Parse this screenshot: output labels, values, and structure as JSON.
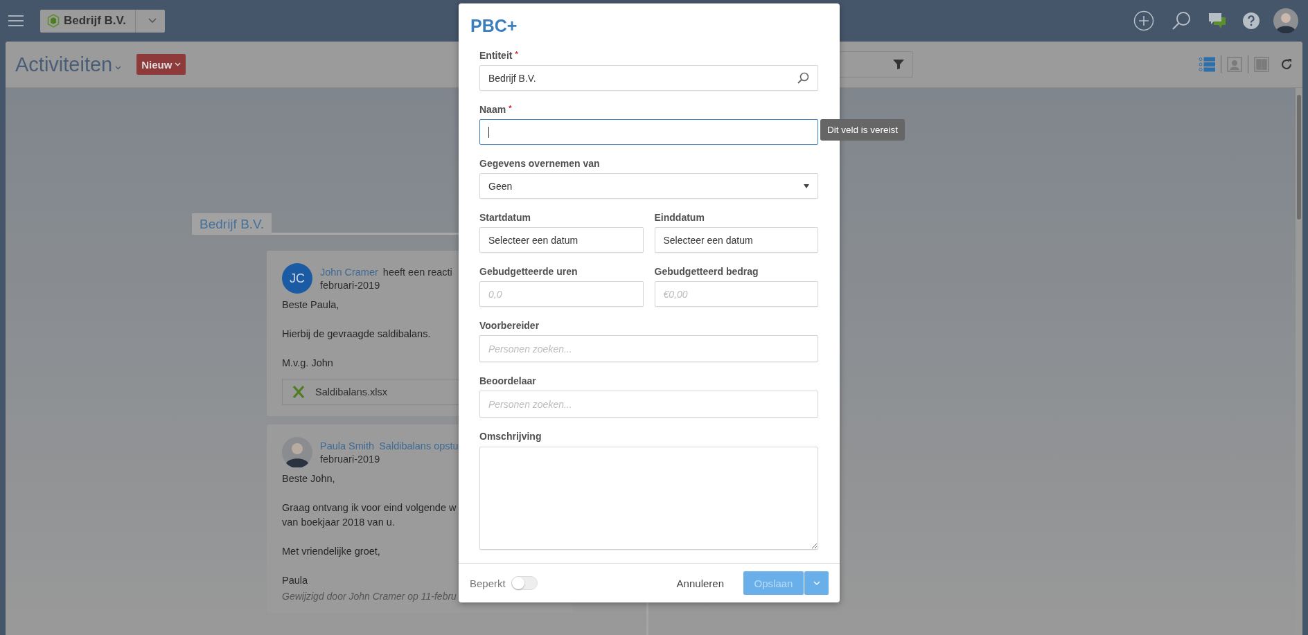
{
  "topbar": {
    "entity": "Bedrijf B.V."
  },
  "header": {
    "title": "Activiteiten",
    "new_button": "Nieuw"
  },
  "view_modes": [
    {
      "selected": true
    },
    {
      "selected": false
    },
    {
      "selected": false
    }
  ],
  "timeline": {
    "group": "Bedrijf B.V.",
    "posts": [
      {
        "kind": "initials",
        "initials": "JC",
        "author": "John Cramer",
        "action": "heeft een reacti",
        "action_is_link": false,
        "date": "februari-2019",
        "paragraphs": [
          "Beste Paula,",
          "Hierbij de gevraagde saldibalans.",
          "M.v.g. John"
        ],
        "attachment": "Saldibalans.xlsx"
      },
      {
        "kind": "photo",
        "author": "Paula Smith",
        "action": "Saldibalans opstu",
        "action_is_link": true,
        "date": "februari-2019",
        "paragraphs": [
          "Beste John,",
          "Graag ontvang ik voor eind volgende w\nvan boekjaar 2018 van u.",
          "Met vriendelijke groet,",
          "Paula"
        ],
        "edited_note": "Gewijzigd door John Cramer op 11-febru"
      }
    ]
  },
  "dialog": {
    "title": "PBC+",
    "required_mark": "*",
    "fields": [
      {
        "kind": "search",
        "label": "Entiteit",
        "required": true,
        "focused": false,
        "value": "Bedrijf B.V."
      },
      {
        "kind": "text",
        "label": "Naam",
        "required": true,
        "focused": true,
        "error": "Dit veld is vereist"
      },
      {
        "kind": "select",
        "label": "Gegevens overnemen van",
        "required": false,
        "focused": false,
        "value": "Geen"
      },
      {
        "kind": "pair",
        "items": [
          {
            "label": "Startdatum",
            "required": false,
            "focused": false,
            "value": "Selecteer een datum"
          },
          {
            "label": "Einddatum",
            "required": false,
            "focused": false,
            "value": "Selecteer een datum"
          }
        ]
      },
      {
        "kind": "pair",
        "items": [
          {
            "label": "Gebudgetteerde uren",
            "required": false,
            "focused": false,
            "placeholder": "0,0"
          },
          {
            "label": "Gebudgetteerd bedrag",
            "required": false,
            "focused": false,
            "placeholder": "€0,00"
          }
        ]
      },
      {
        "kind": "people",
        "label": "Voorbereider",
        "required": false,
        "focused": false,
        "placeholder": "Personen zoeken..."
      },
      {
        "kind": "people",
        "label": "Beoordelaar",
        "required": false,
        "focused": false,
        "placeholder": "Personen zoeken..."
      },
      {
        "kind": "textarea",
        "label": "Omschrijving",
        "required": false,
        "focused": false
      }
    ],
    "restricted": {
      "label": "Beperkt",
      "on": false
    },
    "cancel": "Annuleren",
    "save": {
      "label": "Opslaan",
      "disabled": true
    }
  }
}
